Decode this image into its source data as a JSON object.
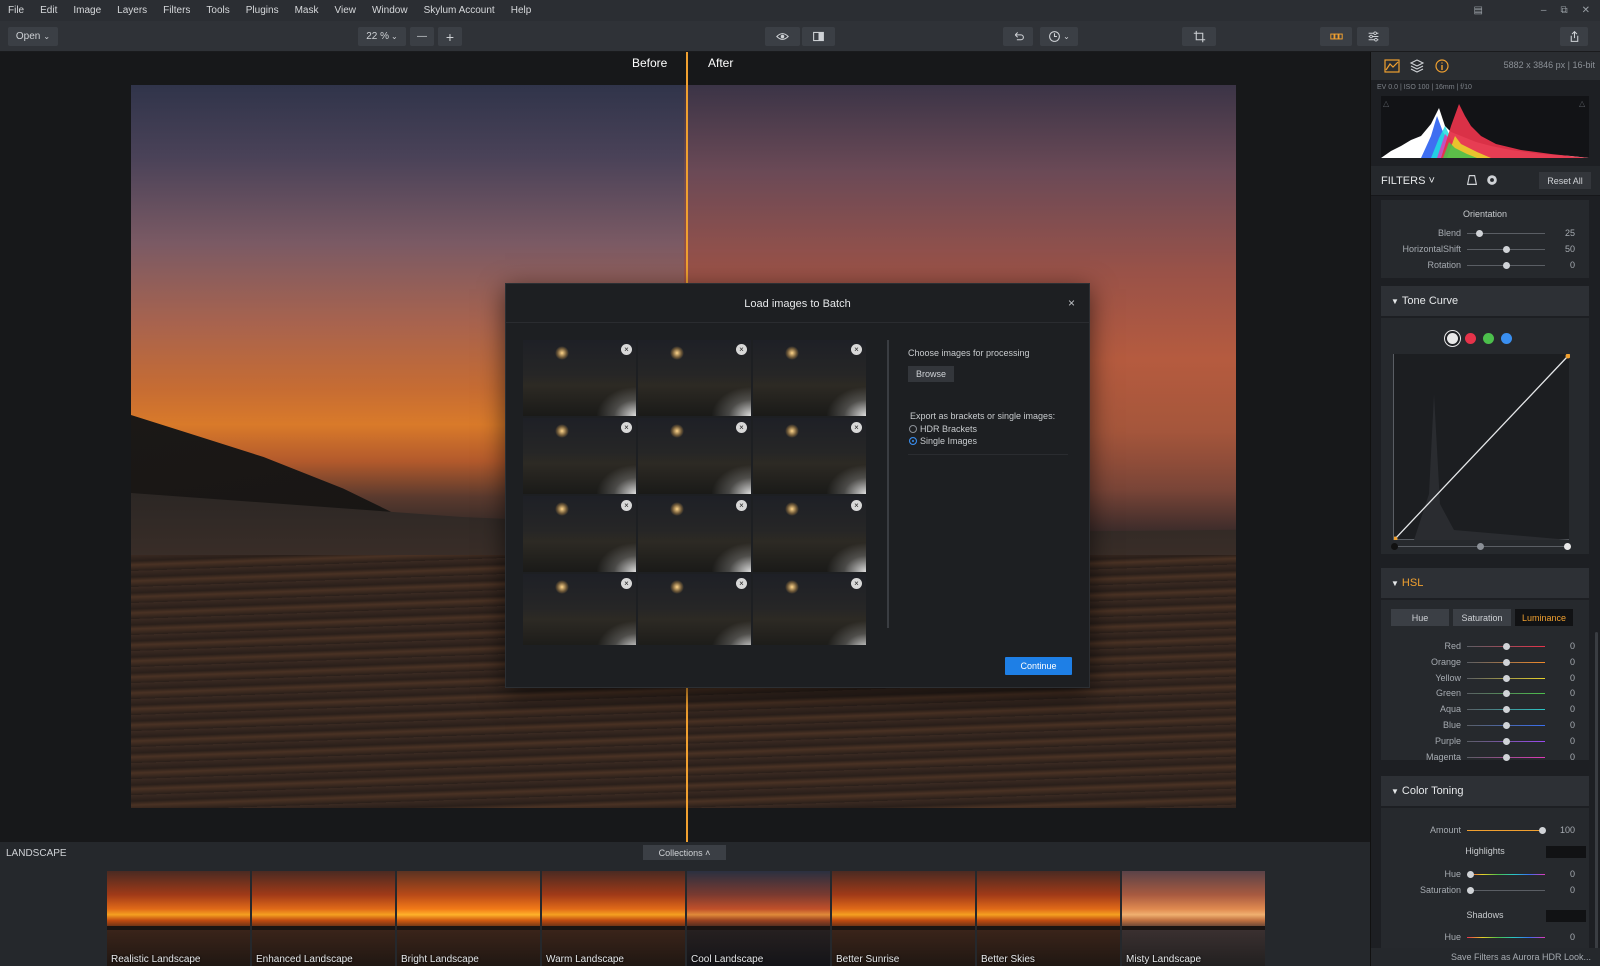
{
  "menu": [
    "File",
    "Edit",
    "Image",
    "Layers",
    "Filters",
    "Tools",
    "Plugins",
    "Mask",
    "View",
    "Window",
    "Skylum Account",
    "Help"
  ],
  "toolbar": {
    "open_label": "Open",
    "zoom_value": "22 %",
    "zoom_out": "—",
    "zoom_in": "+"
  },
  "canvas": {
    "before_label": "Before",
    "after_label": "After"
  },
  "dialog": {
    "title": "Load images to Batch",
    "close": "×",
    "thumb_count": 12,
    "choose_label": "Choose images for processing",
    "browse_label": "Browse",
    "export_label": "Export as brackets or single images:",
    "option_hdr": "HDR Brackets",
    "option_single": "Single Images",
    "selected_option": "Single Images",
    "continue_label": "Continue"
  },
  "bottom": {
    "category_label": "LANDSCAPE",
    "collections_label": "Collections ˄",
    "presets": [
      "Realistic Landscape",
      "Enhanced Landscape",
      "Bright Landscape",
      "Warm Landscape",
      "Cool Landscape",
      "Better Sunrise",
      "Better Skies",
      "Misty Landscape"
    ]
  },
  "rpanel": {
    "image_info": "5882 x 3846 px  |  16-bit",
    "exif": "EV 0.0  |  ISO 100  |  16mm  |  f/10",
    "filters_label": "FILTERS ˅",
    "reset_all": "Reset All",
    "orientation": {
      "title": "Orientation",
      "sliders": [
        {
          "label": "Blend",
          "value": "25",
          "fraction": 0.12
        },
        {
          "label": "HorizontalShift",
          "value": "50",
          "fraction": 0.5
        },
        {
          "label": "Rotation",
          "value": "0",
          "fraction": 0.5
        }
      ]
    },
    "tone_curve": {
      "title": "Tone Curve",
      "channels": [
        "#e8e8e8",
        "#e6334a",
        "#4cbf4c",
        "#3a8ff0"
      ]
    },
    "hsl": {
      "title": "HSL",
      "tabs": [
        "Hue",
        "Saturation",
        "Luminance"
      ],
      "active_tab": "Luminance",
      "sliders": [
        {
          "label": "Red",
          "value": "0",
          "color": "#e6334a"
        },
        {
          "label": "Orange",
          "value": "0",
          "color": "#f08a2a"
        },
        {
          "label": "Yellow",
          "value": "0",
          "color": "#e8d22a"
        },
        {
          "label": "Green",
          "value": "0",
          "color": "#4cbf4c"
        },
        {
          "label": "Aqua",
          "value": "0",
          "color": "#2ac6c6"
        },
        {
          "label": "Blue",
          "value": "0",
          "color": "#3a6ff0"
        },
        {
          "label": "Purple",
          "value": "0",
          "color": "#9a4af0"
        },
        {
          "label": "Magenta",
          "value": "0",
          "color": "#e03ab8"
        }
      ]
    },
    "color_toning": {
      "title": "Color Toning",
      "amount_label": "Amount",
      "amount_value": "100",
      "amount_fraction": 1.0,
      "highlights_label": "Highlights",
      "hue_label": "Hue",
      "hue_value": "0",
      "saturation_label": "Saturation",
      "saturation_value": "0",
      "shadows_label": "Shadows",
      "shadows_hue_label": "Hue",
      "shadows_hue_value": "0"
    },
    "save_filters": "Save Filters as Aurora HDR Look..."
  },
  "colors": {
    "accent": "#f0a030",
    "primary_button": "#1e7fe6"
  }
}
